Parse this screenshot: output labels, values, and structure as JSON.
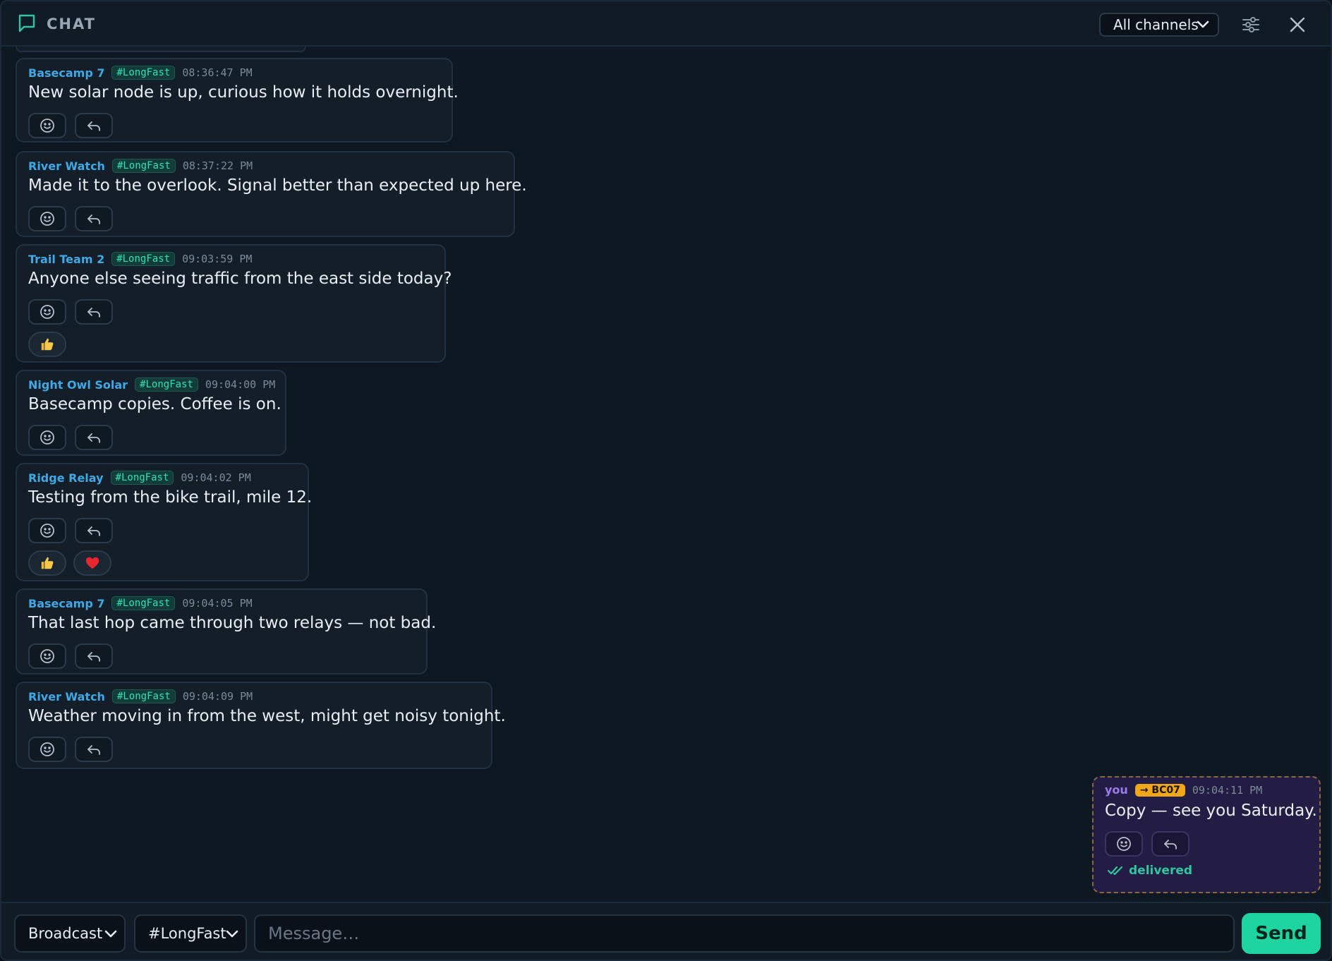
{
  "header": {
    "title": "CHAT",
    "channel_filter": "All channels",
    "icons": [
      "chat-bubble-icon",
      "chevron-down-icon",
      "sliders-icon",
      "close-icon"
    ]
  },
  "messages": [
    {
      "sender": "Basecamp 7",
      "channel": "#LongFast",
      "time": "08:36:47 PM",
      "text": "New solar node is up, curious how it holds overnight.",
      "reactions": []
    },
    {
      "sender": "River Watch",
      "channel": "#LongFast",
      "time": "08:37:22 PM",
      "text": "Made it to the overlook. Signal better than expected up here.",
      "reactions": []
    },
    {
      "sender": "Trail Team 2",
      "channel": "#LongFast",
      "time": "09:03:59 PM",
      "text": "Anyone else seeing traffic from the east side today?",
      "reactions": [
        "thumbs-up-icon"
      ]
    },
    {
      "sender": "Night Owl Solar",
      "channel": "#LongFast",
      "time": "09:04:00 PM",
      "text": "Basecamp copies. Coffee is on.",
      "reactions": []
    },
    {
      "sender": "Ridge Relay",
      "channel": "#LongFast",
      "time": "09:04:02 PM",
      "text": "Testing from the bike trail, mile 12.",
      "reactions": [
        "thumbs-up-icon",
        "heart-icon"
      ]
    },
    {
      "sender": "Basecamp 7",
      "channel": "#LongFast",
      "time": "09:04:05 PM",
      "text": "That last hop came through two relays — not bad.",
      "reactions": []
    },
    {
      "sender": "River Watch",
      "channel": "#LongFast",
      "time": "09:04:09 PM",
      "text": "Weather moving in from the west, might get noisy tonight.",
      "reactions": []
    }
  ],
  "own_message": {
    "sender": "you",
    "destination": "→ BC07",
    "time": "09:04:11 PM",
    "text": "Copy — see you Saturday.",
    "status": "delivered"
  },
  "composer": {
    "mode": "Broadcast",
    "channel": "#LongFast",
    "placeholder": "Message…",
    "send_label": "Send"
  },
  "colors": {
    "accent": "#1ed4a0",
    "sender": "#3fa9e6",
    "own_sender": "#9b7bea",
    "destination_badge": "#f0a81a",
    "channel_tag": "#2ee3b2"
  }
}
